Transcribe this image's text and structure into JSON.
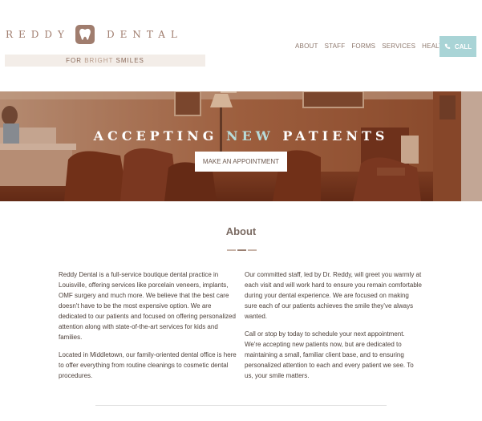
{
  "brand": {
    "name_left": "REDDY",
    "name_right": "DENTAL",
    "tagline": {
      "prefix": "FOR ",
      "highlight": "BRIGHT",
      "suffix": " SMILES"
    }
  },
  "nav": {
    "items": [
      {
        "label": "ABOUT"
      },
      {
        "label": "STAFF"
      },
      {
        "label": "FORMS"
      },
      {
        "label": "SERVICES"
      },
      {
        "label": "HEALTH"
      }
    ],
    "call_label": "CALL"
  },
  "hero": {
    "title_part1": "ACCEPTING ",
    "title_accent": "NEW",
    "title_part2": " PATIENTS",
    "button_label": "MAKE AN APPOINTMENT"
  },
  "about": {
    "heading": "About",
    "left_paragraphs": [
      "Reddy Dental is a full-service boutique dental practice in Louisville, offering services like porcelain veneers, implants, OMF surgery and much more. We believe that the best care doesn't have to be the most expensive option. We are dedicated to our patients and focused on offering personalized attention along with state-of-the-art services for kids and families.",
      "Located in Middletown, our family-oriented dental office is here to offer everything from routine cleanings to cosmetic dental procedures."
    ],
    "right_paragraphs": [
      "Our committed staff, led by Dr. Reddy, will greet you warmly at each visit and will work hard to ensure you remain comfortable during your dental experience. We are focused on making sure each of our patients achieves the smile they've always wanted.",
      "Call or stop by today to schedule your next appointment. We're accepting new patients now, but are dedicated to maintaining a small, familiar client base, and to ensuring personalized attention to each and every patient we see. To us, your smile matters."
    ]
  },
  "colors": {
    "brand_brown": "#a07d6e",
    "accent_teal": "#a9d4d6",
    "hero_tint": "#8a4a2c"
  }
}
